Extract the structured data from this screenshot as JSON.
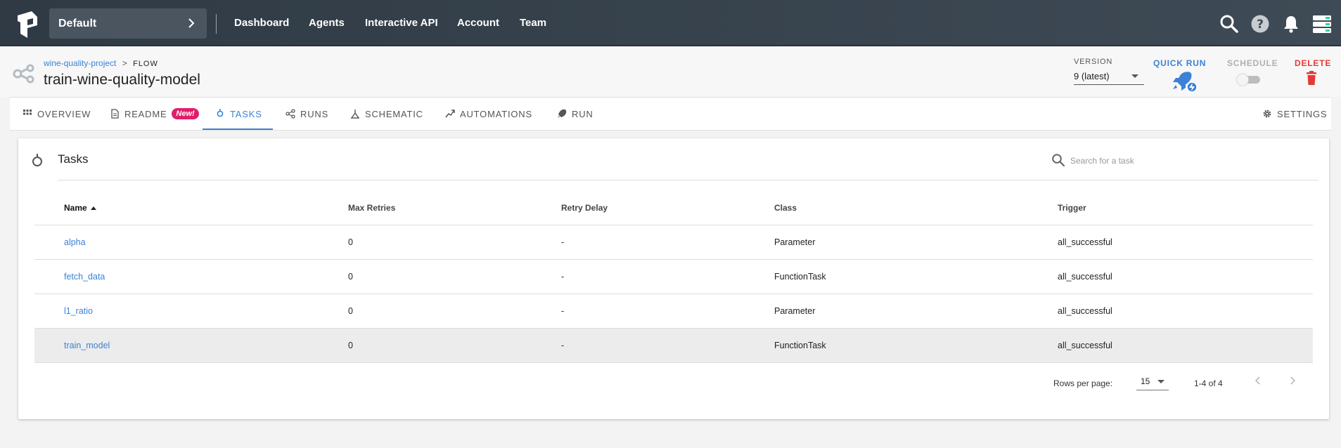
{
  "navbar": {
    "team_name": "Default",
    "links": [
      "Dashboard",
      "Agents",
      "Interactive API",
      "Account",
      "Team"
    ]
  },
  "flow": {
    "project": "wine-quality-project",
    "separator": ">",
    "crumb": "FLOW",
    "title": "train-wine-quality-model",
    "version_label": "VERSION",
    "version_value": "9 (latest)",
    "quick_run_label": "QUICK RUN",
    "schedule_label": "SCHEDULE",
    "schedule_on": false,
    "delete_label": "DELETE"
  },
  "tabs": {
    "overview": "OVERVIEW",
    "readme": "README",
    "readme_badge": "New!",
    "tasks": "TASKS",
    "runs": "RUNS",
    "schematic": "SCHEMATIC",
    "automations": "AUTOMATIONS",
    "run": "RUN",
    "settings": "SETTINGS",
    "active": "tasks"
  },
  "tasks_card": {
    "title": "Tasks",
    "search_placeholder": "Search for a task",
    "columns": [
      "Name",
      "Max Retries",
      "Retry Delay",
      "Class",
      "Trigger"
    ],
    "sorted_column": "Name",
    "rows": [
      {
        "name": "alpha",
        "max_retries": "0",
        "retry_delay": "-",
        "class": "Parameter",
        "trigger": "all_successful"
      },
      {
        "name": "fetch_data",
        "max_retries": "0",
        "retry_delay": "-",
        "class": "FunctionTask",
        "trigger": "all_successful"
      },
      {
        "name": "l1_ratio",
        "max_retries": "0",
        "retry_delay": "-",
        "class": "Parameter",
        "trigger": "all_successful"
      },
      {
        "name": "train_model",
        "max_retries": "0",
        "retry_delay": "-",
        "class": "FunctionTask",
        "trigger": "all_successful"
      }
    ],
    "highlighted_row": 3,
    "pagination": {
      "rows_per_page_label": "Rows per page:",
      "rows_per_page": "15",
      "range": "1-4 of 4"
    }
  },
  "colors": {
    "accent": "#3b82d6",
    "navbar": "#2f3a44",
    "delete": "#e53935",
    "badge": "#e01e6b"
  }
}
